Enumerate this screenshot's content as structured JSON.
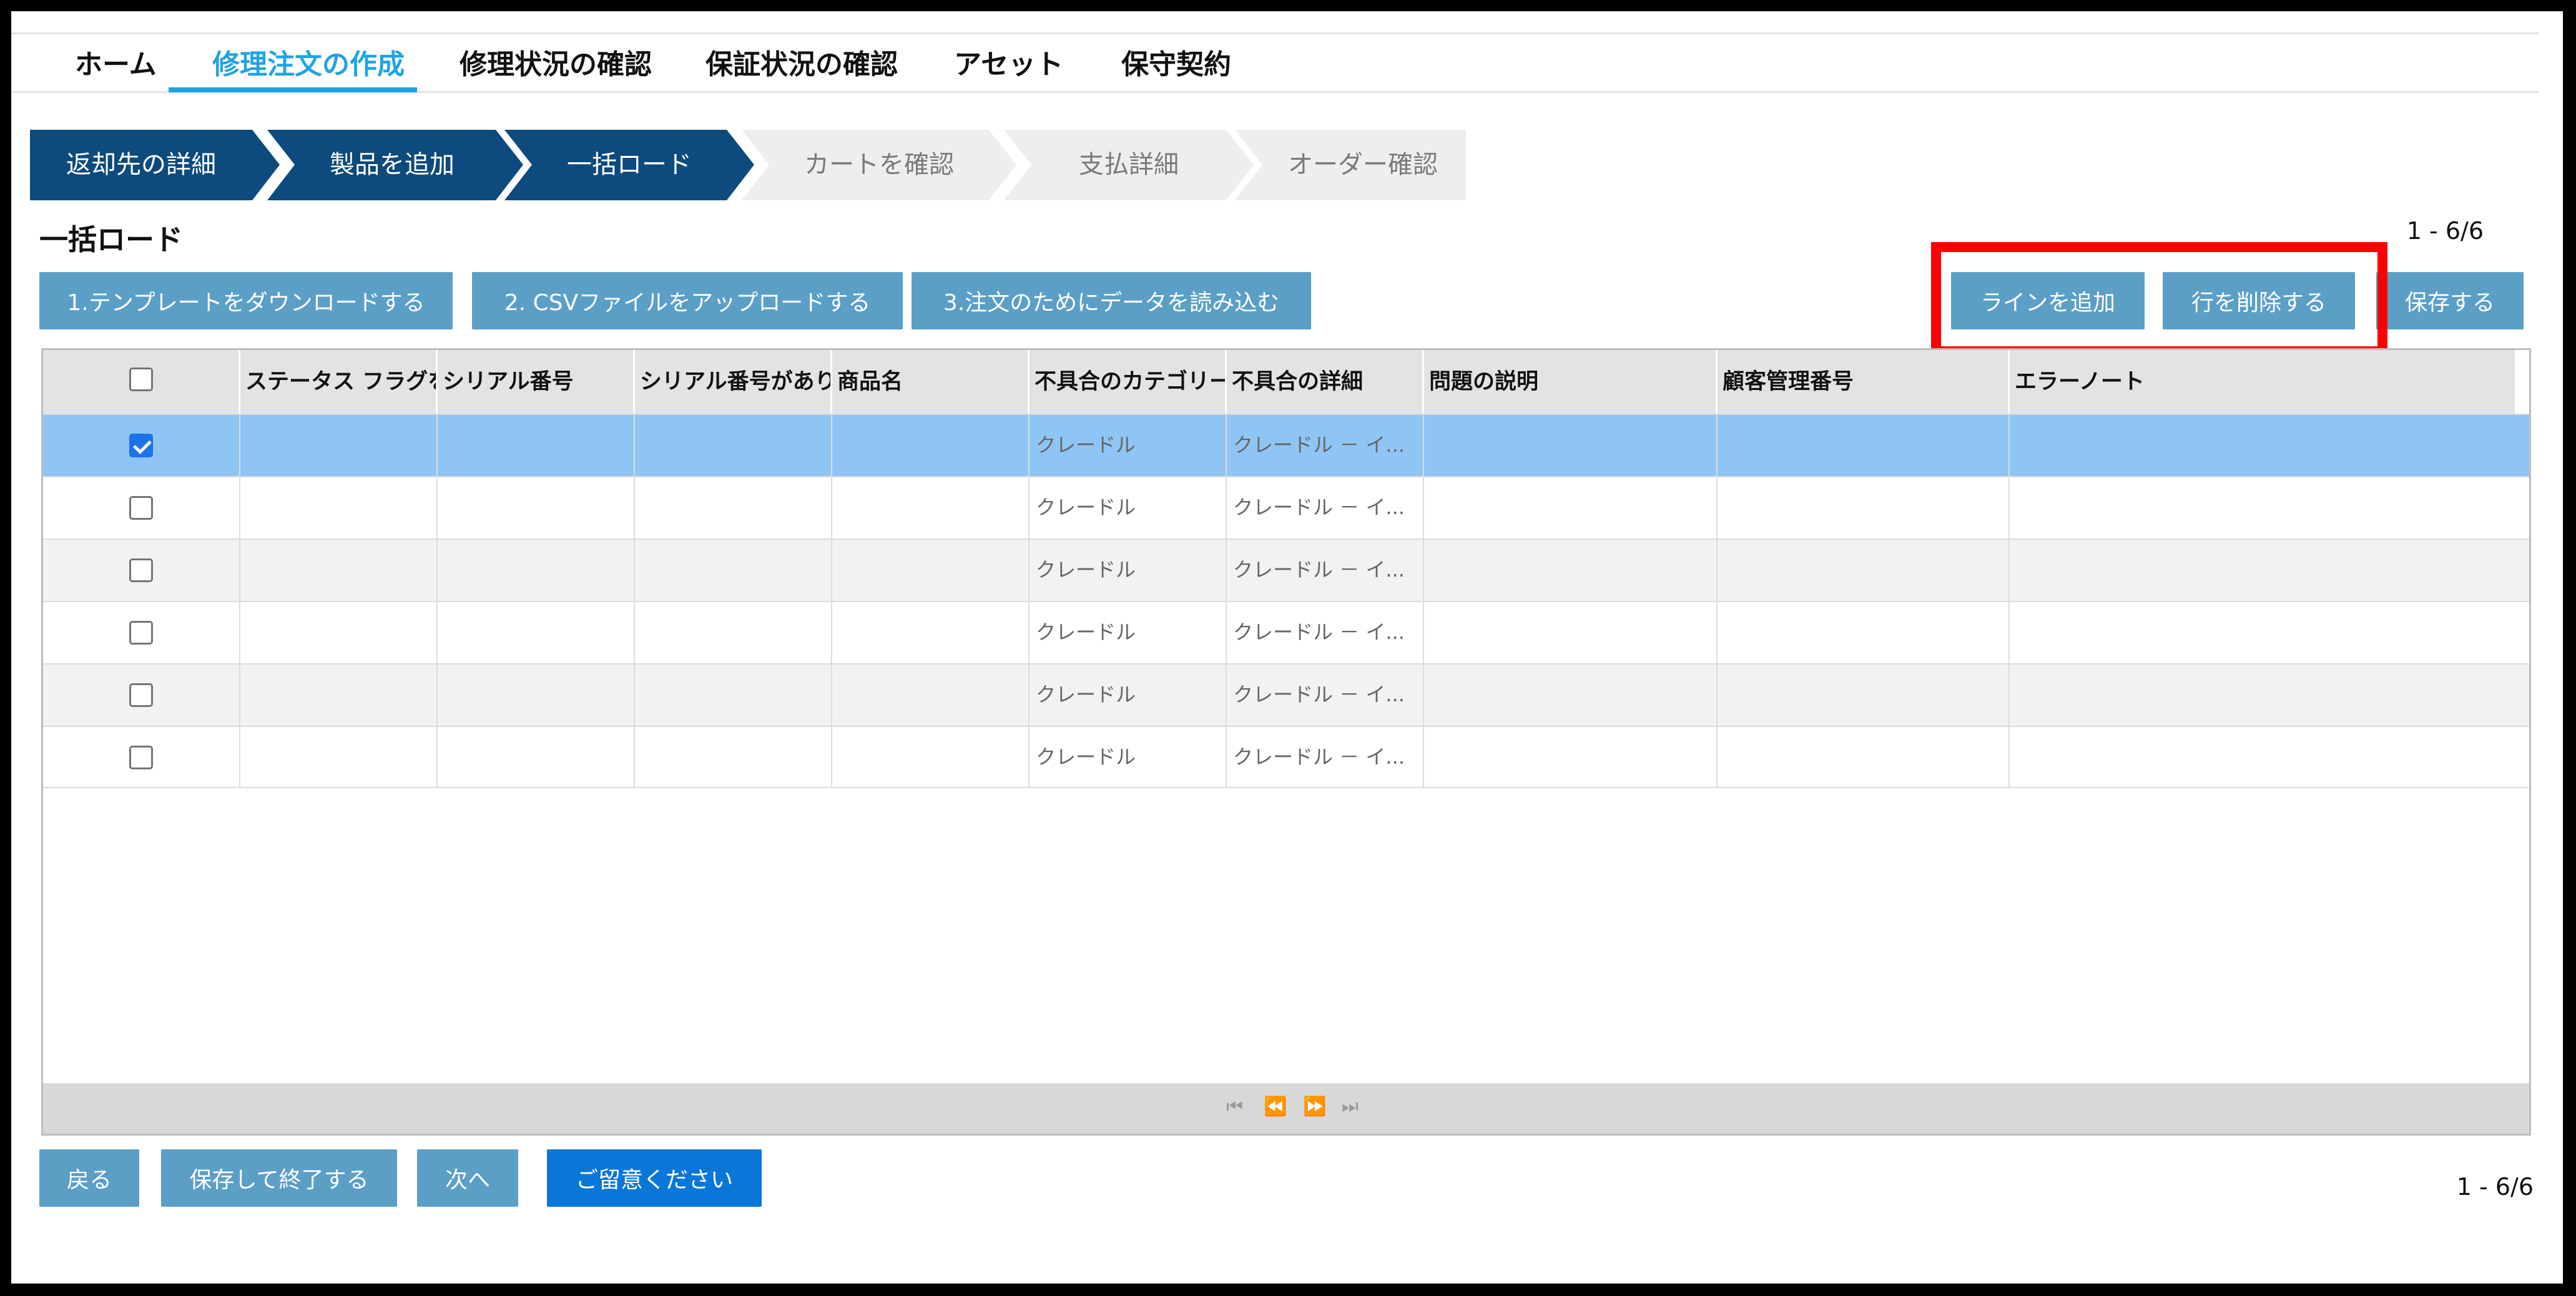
{
  "nav": {
    "tabs": [
      {
        "label": "ホーム",
        "active": false
      },
      {
        "label": "修理注文の作成",
        "active": true
      },
      {
        "label": "修理状況の確認",
        "active": false
      },
      {
        "label": "保証状況の確認",
        "active": false
      },
      {
        "label": "アセット",
        "active": false
      },
      {
        "label": "保守契約",
        "active": false
      }
    ]
  },
  "steps": [
    {
      "label": "返却先の詳細",
      "state": "done"
    },
    {
      "label": "製品を追加",
      "state": "done"
    },
    {
      "label": "一括ロード",
      "state": "done"
    },
    {
      "label": "カートを確認",
      "state": "todo"
    },
    {
      "label": "支払詳細",
      "state": "todo"
    },
    {
      "label": "オーダー確認",
      "state": "todo"
    }
  ],
  "section": {
    "title": "一括ロード",
    "count": "1 - 6/6"
  },
  "actions": {
    "download_template": "1.テンプレートをダウンロードする",
    "upload_csv": "2. CSVファイルをアップロードする",
    "load_data": "3.注文のためにデータを読み込む",
    "add_line": "ラインを追加",
    "delete_row": "行を削除する",
    "save": "保存する"
  },
  "table": {
    "columns": [
      "ステータス フラグを",
      "シリアル番号",
      "シリアル番号があり",
      "商品名",
      "不具合のカテゴリー",
      "不具合の詳細",
      "問題の説明",
      "顧客管理番号",
      "エラーノート"
    ],
    "rows": [
      {
        "checked": true,
        "category": "クレードル",
        "detail": "クレードル － イ..."
      },
      {
        "checked": false,
        "category": "クレードル",
        "detail": "クレードル － イ..."
      },
      {
        "checked": false,
        "category": "クレードル",
        "detail": "クレードル － イ..."
      },
      {
        "checked": false,
        "category": "クレードル",
        "detail": "クレードル － イ..."
      },
      {
        "checked": false,
        "category": "クレードル",
        "detail": "クレードル － イ..."
      },
      {
        "checked": false,
        "category": "クレードル",
        "detail": "クレードル － イ..."
      }
    ]
  },
  "footer": {
    "back": "戻る",
    "save_exit": "保存して終了する",
    "next": "次へ",
    "notice": "ご留意ください",
    "count": "1 - 6/6"
  },
  "colors": {
    "accent": "#1ea3e4",
    "step_done": "#0d4a7d",
    "step_todo": "#eeeeee",
    "button": "#5b9fc7",
    "button_primary": "#0a77d8",
    "selected_row": "#8ec5f5",
    "highlight": "#ff0000"
  },
  "icons": {
    "pager": [
      "first-page-icon",
      "prev-page-icon",
      "next-page-icon",
      "last-page-icon"
    ]
  }
}
